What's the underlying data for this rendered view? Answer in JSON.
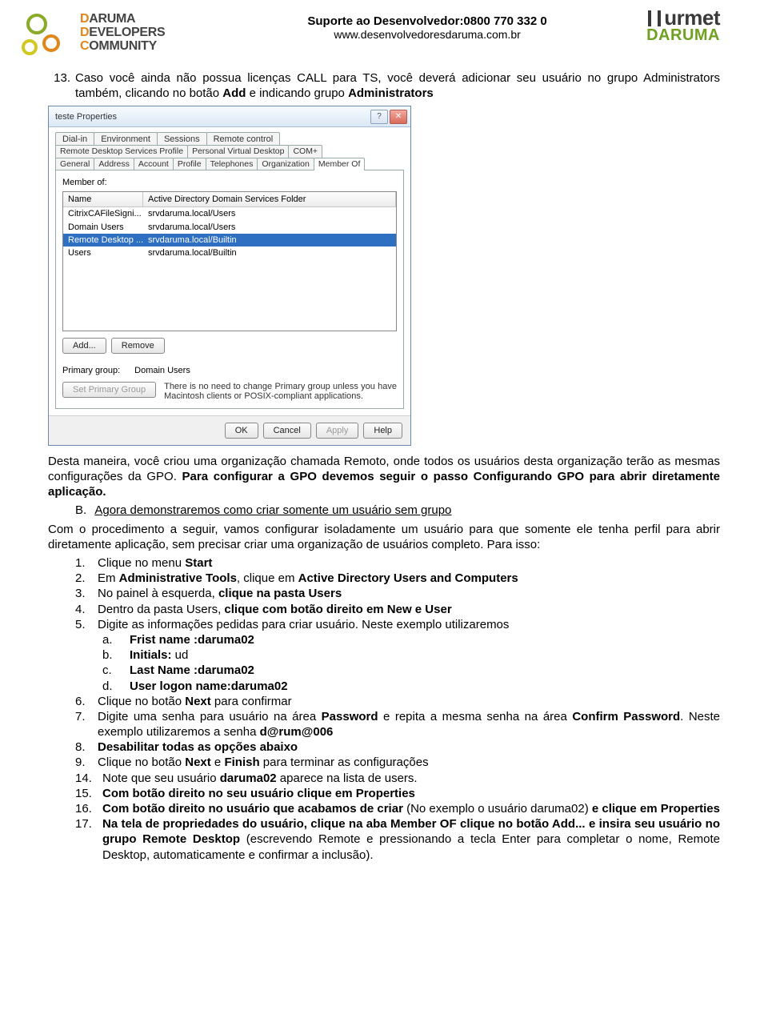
{
  "header": {
    "logo_left_line1_d": "D",
    "logo_left_line1_rest": "ARUMA",
    "logo_left_line2_d": "D",
    "logo_left_line2_rest": "EVELOPERS",
    "logo_left_line3_c": "C",
    "logo_left_line3_rest": "OMMUNITY",
    "center_line1": "Suporte ao Desenvolvedor:0800 770 332 0",
    "center_line2": "www.desenvolvedoresdaruma.com.br",
    "logo_right_top": "urmet",
    "logo_right_bottom": "DARUMA"
  },
  "intro": {
    "num": "13.",
    "text_1": "Caso você ainda não possua licenças CALL para TS, você deverá adicionar seu usuário no grupo Administrators também, clicando no botão ",
    "bold1": "Add",
    "text_2": " e indicando grupo ",
    "bold2": "Administrators"
  },
  "dialog": {
    "title": "teste Properties",
    "help_btn": "?",
    "close_btn": "✕",
    "tabs_row1": [
      "Dial-in",
      "Environment",
      "Sessions",
      "Remote control"
    ],
    "tabs_row2": [
      "Remote Desktop Services Profile",
      "Personal Virtual Desktop",
      "COM+"
    ],
    "tabs_row3": [
      "General",
      "Address",
      "Account",
      "Profile",
      "Telephones",
      "Organization",
      "Member Of"
    ],
    "member_of_label": "Member of:",
    "col_name": "Name",
    "col_folder": "Active Directory Domain Services Folder",
    "rows": [
      {
        "name": "CitrixCAFileSigni...",
        "folder": "srvdaruma.local/Users"
      },
      {
        "name": "Domain Users",
        "folder": "srvdaruma.local/Users"
      },
      {
        "name": "Remote Desktop ...",
        "folder": "srvdaruma.local/Builtin",
        "selected": true
      },
      {
        "name": "Users",
        "folder": "srvdaruma.local/Builtin"
      }
    ],
    "add_btn": "Add...",
    "remove_btn": "Remove",
    "primary_label": "Primary group:",
    "primary_value": "Domain Users",
    "set_primary_btn": "Set Primary Group",
    "hint": "There is no need to change Primary group unless you have Macintosh clients or POSIX-compliant applications.",
    "ok": "OK",
    "cancel": "Cancel",
    "apply": "Apply",
    "help": "Help"
  },
  "after_dialog": {
    "p1_a": "Desta maneira, você criou uma organização chamada Remoto, onde todos os usuários desta organização terão as mesmas configurações da GPO. ",
    "p1_bold": "Para configurar a GPO devemos seguir o passo Configurando GPO para abrir diretamente aplicação.",
    "section_B_label": "B.",
    "section_B_title": "Agora demonstraremos como criar somente um usuário sem grupo",
    "p2": "Com o procedimento a seguir, vamos configurar isoladamente um usuário para que somente ele tenha perfil para abrir diretamente aplicação, sem precisar criar uma organização de usuários completo. Para isso:"
  },
  "steps": [
    {
      "n": "1.",
      "pre": "Clique no menu ",
      "b": "Start"
    },
    {
      "n": "2.",
      "pre": "Em ",
      "b": "Administrative Tools",
      "mid": ", clique em ",
      "b2": "Active Directory Users and Computers"
    },
    {
      "n": "3.",
      "pre": "No painel à esquerda, ",
      "b": "clique na pasta Users"
    },
    {
      "n": "4.",
      "pre": "Dentro da pasta Users, ",
      "b": "clique com botão direito em New e User"
    },
    {
      "n": "5.",
      "pre": "Digite as informações pedidas para criar usuário. Neste exemplo utilizaremos"
    }
  ],
  "substeps": [
    {
      "l": "a.",
      "b": "Frist name :",
      "v": "daruma02"
    },
    {
      "l": "b.",
      "b": "Initials:",
      "v": " ud"
    },
    {
      "l": "c.",
      "b": "Last Name :",
      "v": "daruma02"
    },
    {
      "l": "d.",
      "b": "User logon name:",
      "v": "daruma02"
    }
  ],
  "steps2": [
    {
      "n": "6.",
      "pre": "Clique no botão ",
      "b": "Next",
      "post": " para confirmar"
    },
    {
      "n": "7.",
      "pre": "Digite uma senha para usuário na área ",
      "b": "Password",
      "mid": " e repita a mesma senha na área ",
      "b2": "Confirm Password",
      "post": ". Neste exemplo utilizaremos a senha ",
      "b3": "d@rum@006"
    },
    {
      "n": "8.",
      "b": "Desabilitar todas as opções abaixo"
    },
    {
      "n": "9.",
      "pre": "Clique no botão ",
      "b": "Next",
      "mid": " e ",
      "b2": "Finish",
      "post": " para terminar as configurações"
    }
  ],
  "steps3": [
    {
      "n": "14.",
      "pre": "Note que seu usuário ",
      "b": "daruma02",
      "post": " aparece na lista de users."
    },
    {
      "n": "15.",
      "b": "Com botão direito no seu usuário clique em Properties"
    },
    {
      "n": "16.",
      "b": "Com botão direito no usuário que acabamos de criar",
      "mid": " (No exemplo o usuário daruma02) ",
      "b2": "e clique em Properties"
    },
    {
      "n": "17.",
      "b": "Na tela de propriedades do usuário, clique na aba Member OF clique no botão Add...",
      "mid": " ",
      "b2": "e insira seu usuário no grupo Remote Desktop",
      "post": " (escrevendo Remote e pressionando a tecla Enter para completar o nome, Remote Desktop, automaticamente e confirmar a inclusão)."
    }
  ]
}
